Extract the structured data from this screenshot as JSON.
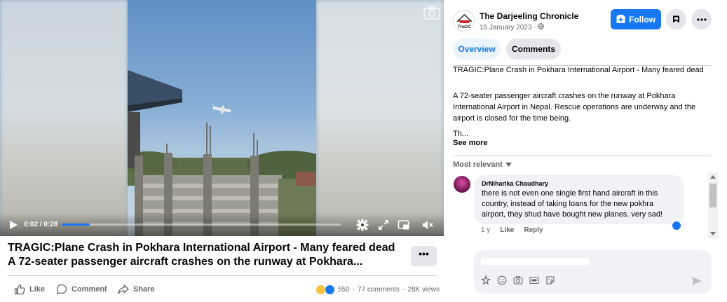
{
  "video": {
    "current_time": "0:02",
    "separator": "/",
    "duration": "0:28",
    "progress_fraction": 0.1,
    "icons": [
      "play-icon",
      "settings-icon",
      "expand-icon",
      "picture-in-picture-icon",
      "volume-muted-icon",
      "camera-icon"
    ]
  },
  "post": {
    "title_line1": "TRAGIC:Plane Crash in Pokhara International Airport - Many feared dead",
    "title_line2": "A 72-seater passenger aircraft crashes on the runway at Pokhara...",
    "more_label": "•••",
    "actions": {
      "like": "Like",
      "comment": "Comment",
      "share": "Share"
    },
    "stats": {
      "reactions": "550",
      "comments": "77 comments",
      "dot": "·",
      "views": "28K views"
    }
  },
  "page": {
    "name": "The Darjeeling Chronicle",
    "logo_text": "TheDC",
    "date": "15 January 2023",
    "privacy_icon": "globe-icon",
    "follow_label": "Follow"
  },
  "tabs": {
    "overview": "Overview",
    "comments": "Comments"
  },
  "description": {
    "headline": "TRAGIC:Plane Crash in Pokhara International Airport - Many feared dead",
    "body": "A 72-seater passenger aircraft crashes on the runway at Pokhara International Airport in Nepal. Rescue operations are underway and the airport is closed for the time being.",
    "truncated": "Th...",
    "see_more": "See more"
  },
  "comments": {
    "sort_label": "Most relevant",
    "items": [
      {
        "author": "DrNiharika Chaudhary",
        "text": "there is not even one single first hand aircraft in this country, instead of taking loans for the new pokhra airport, they shud have bought new planes. very sad!",
        "age": "1 y",
        "like_label": "Like",
        "reply_label": "Reply"
      }
    ]
  },
  "composer": {
    "placeholder": ""
  },
  "colors": {
    "accent": "#1877f2",
    "surface": "#f0f2f5",
    "button_grey": "#e4e6eb",
    "secondary_text": "#65676b"
  }
}
